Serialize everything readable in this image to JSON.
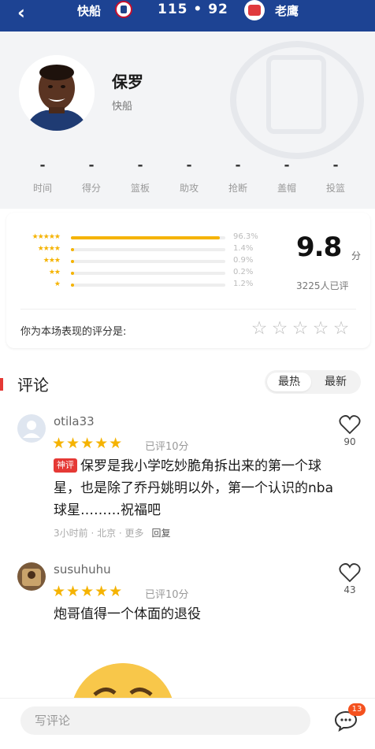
{
  "topbar": {
    "back_icon": "chevron-left-icon",
    "home_team": "快船",
    "score": "115 • 92",
    "away_team": "老鹰"
  },
  "player": {
    "name": "保罗",
    "team": "快船"
  },
  "stats": [
    {
      "label": "时间",
      "value": "-"
    },
    {
      "label": "得分",
      "value": "-"
    },
    {
      "label": "篮板",
      "value": "-"
    },
    {
      "label": "助攻",
      "value": "-"
    },
    {
      "label": "抢断",
      "value": "-"
    },
    {
      "label": "盖帽",
      "value": "-"
    },
    {
      "label": "投篮",
      "value": "-"
    }
  ],
  "rating": {
    "rows": [
      {
        "stars": "★★★★★",
        "pct": "96.3%",
        "fraction": 0.963
      },
      {
        "stars": "★★★★",
        "pct": "1.4%",
        "fraction": 0.014
      },
      {
        "stars": "★★★",
        "pct": "0.9%",
        "fraction": 0.009
      },
      {
        "stars": "★★",
        "pct": "0.2%",
        "fraction": 0.002
      },
      {
        "stars": "★",
        "pct": "1.2%",
        "fraction": 0.012
      }
    ],
    "score": "9.8",
    "unit": "分",
    "raters": "3225人已评",
    "your_label": "你为本场表现的评分是:"
  },
  "comments_section": {
    "title": "评论",
    "sort_hot": "最热",
    "sort_new": "最新"
  },
  "comments": [
    {
      "user": "otila33",
      "stars": "★★★★★",
      "rated": "已评10分",
      "badge": "神评",
      "text": "保罗是我小学吃妙脆角拆出来的第一个球星，也是除了乔丹姚明以外，第一个认识的nba球星………祝福吧",
      "meta": "3小时前 · 北京 · 更多",
      "reply": "回复",
      "likes": "90"
    },
    {
      "user": "susuhuhu",
      "stars": "★★★★★",
      "rated": "已评10分",
      "text": "炮哥值得一个体面的退役",
      "likes": "43"
    }
  ],
  "bottom": {
    "write_placeholder": "写评论",
    "chat_badge": "13"
  },
  "colors": {
    "nav": "#1d4393",
    "star": "#f5b301",
    "accent": "#e53935"
  }
}
